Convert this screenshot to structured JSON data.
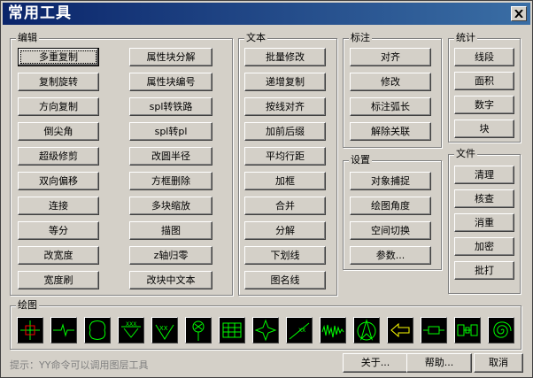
{
  "window": {
    "title": "常用工具"
  },
  "groups": {
    "edit": {
      "label": "编辑",
      "col1": [
        "多重复制",
        "复制旋转",
        "方向复制",
        "倒尖角",
        "超级修剪",
        "双向偏移",
        "连接",
        "等分",
        "改宽度",
        "宽度刷"
      ],
      "col2": [
        "属性块分解",
        "属性块编号",
        "spl转铁路",
        "spl转pl",
        "改圆半径",
        "方框删除",
        "多块缩放",
        "描图",
        "z轴归零",
        "改块中文本"
      ]
    },
    "text": {
      "label": "文本",
      "items": [
        "批量修改",
        "递增复制",
        "按线对齐",
        "加前后缀",
        "平均行距",
        "加框",
        "合并",
        "分解",
        "下划线",
        "图名线"
      ]
    },
    "dim": {
      "label": "标注",
      "items": [
        "对齐",
        "修改",
        "标注弧长",
        "解除关联"
      ]
    },
    "settings": {
      "label": "设置",
      "items": [
        "对象捕捉",
        "绘图角度",
        "空间切换",
        "参数..."
      ]
    },
    "stats": {
      "label": "统计",
      "items": [
        "线段",
        "面积",
        "数字",
        "块"
      ]
    },
    "file": {
      "label": "文件",
      "items": [
        "清理",
        "核查",
        "消重",
        "加密",
        "批打"
      ]
    },
    "draw": {
      "label": "绘图",
      "icons": [
        "crosshair-icon",
        "break-line-icon",
        "cloud-outline-icon",
        "section-arrow-icon",
        "weld-symbol-icon",
        "center-mark-icon",
        "grid-table-icon",
        "star-shape-icon",
        "slope-line-icon",
        "wave-line-icon",
        "north-arrow-icon",
        "left-arrow-icon",
        "resistor-icon",
        "block-chain-icon",
        "spiral-icon"
      ]
    }
  },
  "footer": {
    "hint": "提示：YY命令可以调用图层工具",
    "about": "关于...",
    "help": "帮助...",
    "cancel": "取消"
  }
}
